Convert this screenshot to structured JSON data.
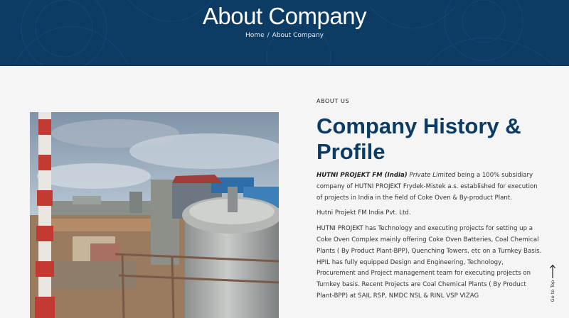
{
  "hero": {
    "title": "About Company",
    "breadcrumb": {
      "home": "Home",
      "separator": "/",
      "current": "About Company"
    },
    "background_color": "#0c3b64"
  },
  "photo": {
    "subject": "industrial coke oven plant with red-and-white chimney and steel tank"
  },
  "about": {
    "eyebrow": "ABOUT US",
    "heading": "Company History & Profile",
    "intro_bold": "HUTNI PROJEKT FM (India)",
    "intro_italic": "Private Limited",
    "intro_rest": " being a 100% subsidiary company of HUTNI PROJEKT Frydek-Mistek a.s. established for execution of projects in India in the field of Coke Oven & By-product Plant.",
    "company_line": "Hutni Projekt FM India Pvt. Ltd.",
    "paragraph": "HUTNI PROJEKT has Technology and executing projects for setting up a Coke Oven Complex mainly offering Coke Oven Batteries, Coal Chemical Plants ( By Product Plant-BPP), Quenching Towers, etc on a Turnkey Basis. HPIL has fully equipped Design and Engineering, Technology, Procurement and Project management team for executing projects on Turnkey basis. Recent Projects are Coal Chemical Plants ( By Product Plant-BPP) at SAIL RSP, NMDC NSL & RINL VSP VIZAG",
    "heading_color": "#0c3b64"
  },
  "go_top": {
    "label": "Go to Top",
    "icon": "arrow-up-icon"
  }
}
